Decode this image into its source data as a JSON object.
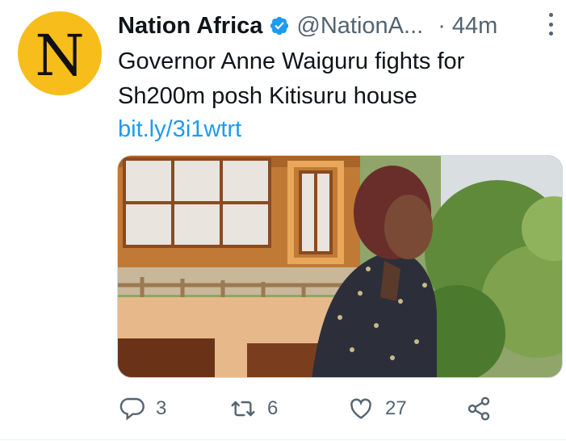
{
  "tweet": {
    "avatar_letter": "N",
    "author_name": "Nation Africa",
    "author_handle": "@NationA...",
    "separator": "·",
    "time": "44m",
    "text": "Governor Anne Waiguru fights for Sh200m posh Kitisuru house",
    "link": "bit.ly/3i1wtrt"
  },
  "actions": {
    "reply_count": "3",
    "retweet_count": "6",
    "like_count": "27"
  },
  "colors": {
    "avatar_bg": "#f7bd1a",
    "verified": "#1d9bf0",
    "link": "#1d9bf0",
    "muted": "#536471"
  },
  "icons": [
    "verified-badge-icon",
    "more-options-icon",
    "reply-icon",
    "retweet-icon",
    "like-icon",
    "share-icon"
  ]
}
